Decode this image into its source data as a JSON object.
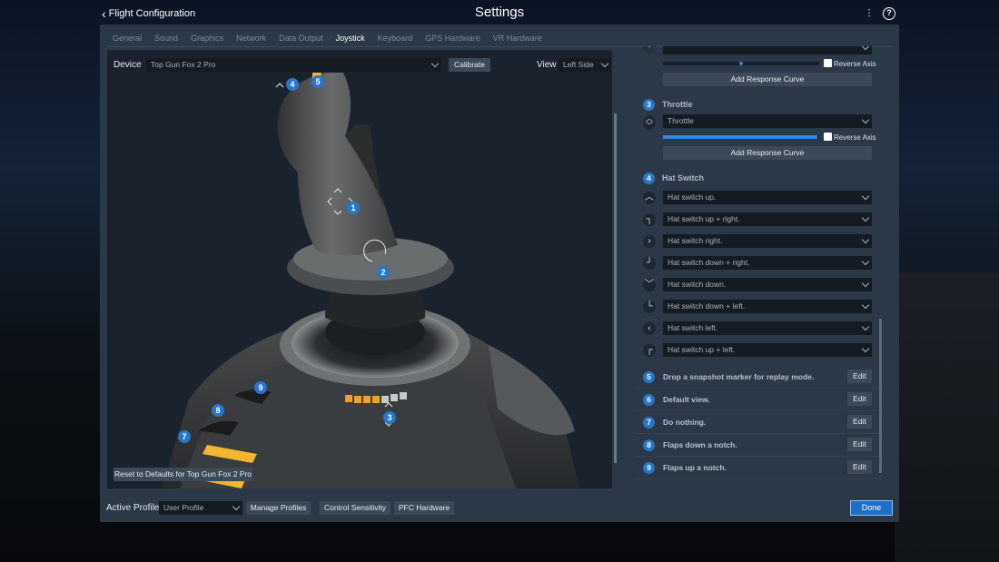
{
  "header": {
    "back_label": "Flight Configuration",
    "title": "Settings"
  },
  "tabs": [
    {
      "label": "General"
    },
    {
      "label": "Sound"
    },
    {
      "label": "Graphics"
    },
    {
      "label": "Network"
    },
    {
      "label": "Data Output"
    },
    {
      "label": "Joystick"
    },
    {
      "label": "Keyboard"
    },
    {
      "label": "GPS Hardware"
    },
    {
      "label": "VR Hardware"
    }
  ],
  "active_tab": "Joystick",
  "left": {
    "device_label": "Device",
    "device_value": "Top Gun Fox 2  Pro",
    "calibrate_label": "Calibrate",
    "view_label": "View",
    "view_value": "Left Side",
    "reset_label": "Reset to Defaults for Top Gun Fox 2  Pro",
    "markers": [
      "1",
      "2",
      "3",
      "4",
      "5",
      "7",
      "8",
      "9"
    ]
  },
  "right": {
    "top_reverse_label": "Reverse Axis",
    "top_curve_label": "Add Response Curve",
    "throttle": {
      "num": "3",
      "label": "Throttle",
      "select_value": "Throttle",
      "axis_fill": 0.99,
      "reverse_label": "Reverse Axis",
      "curve_label": "Add Response Curve"
    },
    "top_axis_fill": 0.5,
    "hat": {
      "num": "4",
      "label": "Hat Switch",
      "rows": [
        {
          "icon": "hat-up-icon",
          "glyph": "︿",
          "value": "Hat switch up."
        },
        {
          "icon": "hat-up-right-icon",
          "glyph": "┐",
          "value": "Hat switch up + right."
        },
        {
          "icon": "hat-right-icon",
          "glyph": "›",
          "value": "Hat switch right."
        },
        {
          "icon": "hat-down-right-icon",
          "glyph": "┘",
          "value": "Hat switch down + right."
        },
        {
          "icon": "hat-down-icon",
          "glyph": "﹀",
          "value": "Hat switch down."
        },
        {
          "icon": "hat-down-left-icon",
          "glyph": "└",
          "value": "Hat switch down + left."
        },
        {
          "icon": "hat-left-icon",
          "glyph": "‹",
          "value": "Hat switch left."
        },
        {
          "icon": "hat-up-left-icon",
          "glyph": "┌",
          "value": "Hat switch up + left."
        }
      ]
    },
    "actions": [
      {
        "num": "5",
        "label": "Drop a snapshot marker for replay mode.",
        "edit": "Edit"
      },
      {
        "num": "6",
        "label": "Default view.",
        "edit": "Edit"
      },
      {
        "num": "7",
        "label": "Do nothing.",
        "edit": "Edit"
      },
      {
        "num": "8",
        "label": "Flaps down a notch.",
        "edit": "Edit"
      },
      {
        "num": "9",
        "label": "Flaps up a notch.",
        "edit": "Edit"
      }
    ]
  },
  "bottom": {
    "active_profile_label": "Active Profile",
    "profile_value": "User Profile",
    "manage_label": "Manage Profiles",
    "sensitivity_label": "Control Sensitivity",
    "pfc_label": "PFC Hardware",
    "done_label": "Done"
  },
  "colors": {
    "accent": "#2677c9",
    "dialog_bg": "#2b3847",
    "pane_bg": "#1a232d"
  }
}
